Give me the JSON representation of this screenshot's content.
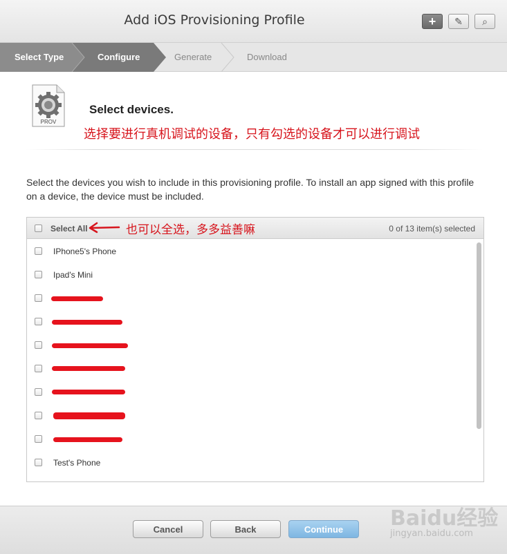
{
  "window": {
    "title": "Add iOS Provisioning Profile",
    "toolbar": [
      {
        "name": "add-button",
        "icon": "plus-icon",
        "glyph": "+"
      },
      {
        "name": "edit-button",
        "icon": "pencil-icon",
        "glyph": "✎"
      },
      {
        "name": "search-button",
        "icon": "search-icon",
        "glyph": "⌕"
      }
    ]
  },
  "steps": [
    {
      "label": "Select Type",
      "state": "done"
    },
    {
      "label": "Configure",
      "state": "current"
    },
    {
      "label": "Generate",
      "state": "pending"
    },
    {
      "label": "Download",
      "state": "pending"
    }
  ],
  "header": {
    "icon_label": "PROV",
    "title": "Select devices.",
    "annotation": "选择要进行真机调试的设备，只有勾选的设备才可以进行调试"
  },
  "description": "Select the devices you wish to include in this provisioning profile. To install an app signed with this profile on a device, the device must be included.",
  "device_list": {
    "select_all_label": "Select All",
    "select_all_annotation": "也可以全选，多多益善嘛",
    "count_text": "0 of 13 item(s) selected",
    "items": [
      {
        "label": "IPhone5's Phone",
        "redacted": false
      },
      {
        "label": "Ipad's Mini",
        "redacted": false
      },
      {
        "label": "",
        "redacted": true
      },
      {
        "label": "",
        "redacted": true
      },
      {
        "label": "",
        "redacted": true
      },
      {
        "label": "",
        "redacted": true
      },
      {
        "label": "",
        "redacted": true
      },
      {
        "label": "",
        "redacted": true
      },
      {
        "label": "",
        "redacted": true
      },
      {
        "label": "Test's Phone",
        "redacted": false
      }
    ]
  },
  "footer": {
    "cancel_label": "Cancel",
    "back_label": "Back",
    "continue_label": "Continue"
  },
  "watermark": {
    "brand": "Baidu经验",
    "url": "jingyan.baidu.com"
  },
  "colors": {
    "annotation_red": "#d7141c",
    "step_done": "#8a8a8a",
    "step_current": "#7a7a7a",
    "continue_blue": "#8dc3ea"
  }
}
